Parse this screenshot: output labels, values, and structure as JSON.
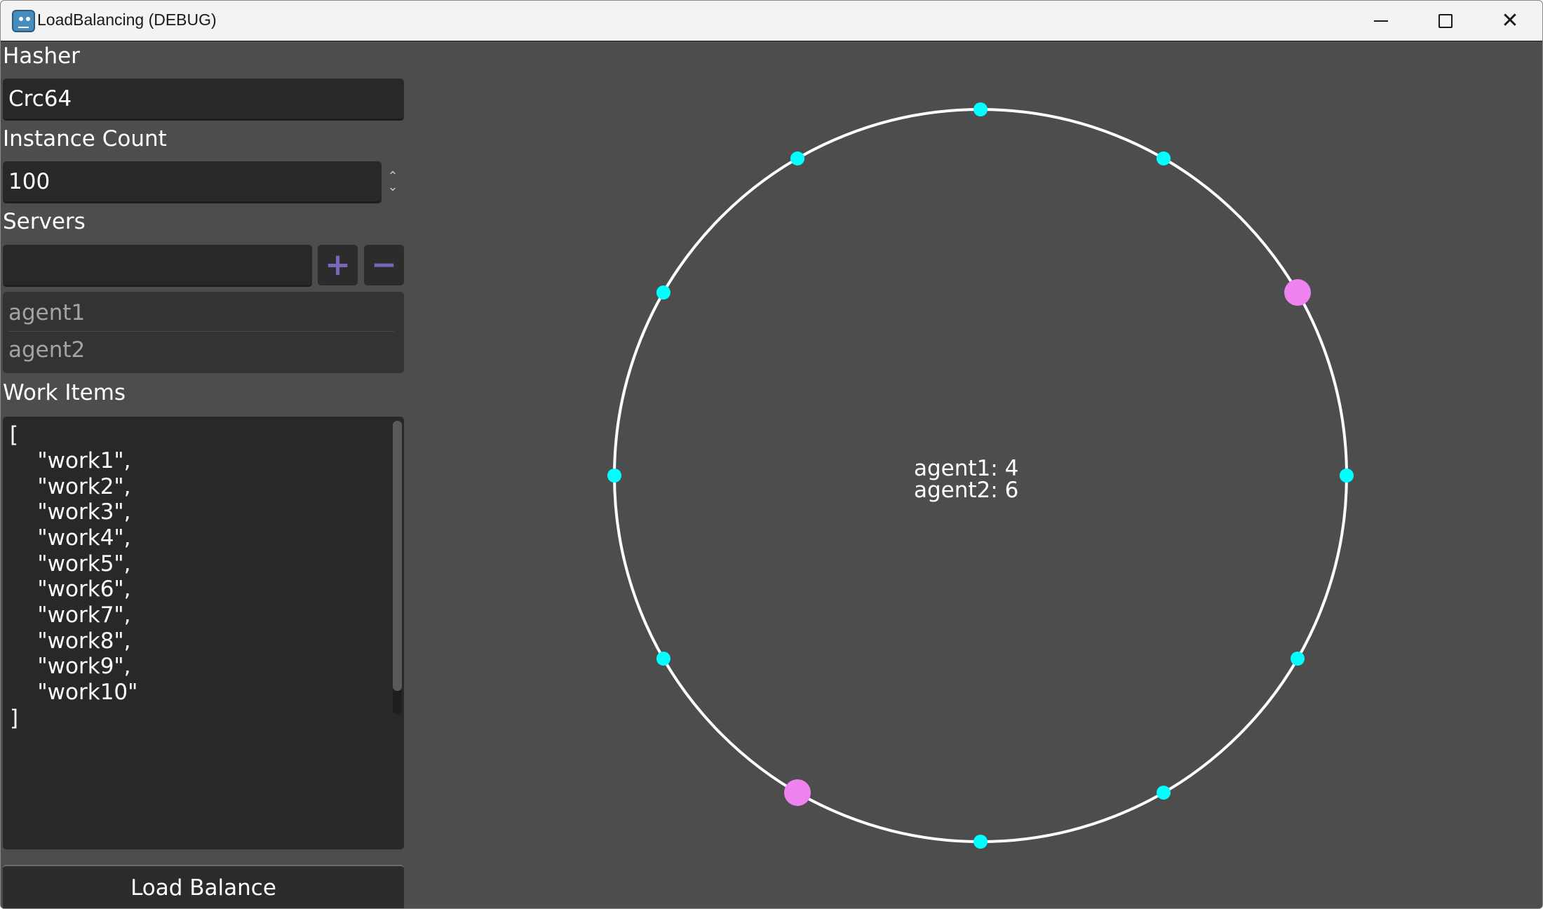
{
  "window": {
    "title": "LoadBalancing (DEBUG)",
    "minimize": "minimize",
    "maximize": "maximize",
    "close": "close"
  },
  "hasher": {
    "label": "Hasher",
    "value": "Crc64"
  },
  "instance_count": {
    "label": "Instance Count",
    "value": "100"
  },
  "servers": {
    "label": "Servers",
    "input_value": "",
    "add_label": "+",
    "remove_label": "−",
    "items": [
      "agent1",
      "agent2"
    ]
  },
  "work_items": {
    "label": "Work Items",
    "lines": [
      "[",
      "    \"work1\",",
      "    \"work2\",",
      "    \"work3\",",
      "    \"work4\",",
      "    \"work5\",",
      "    \"work6\",",
      "    \"work7\",",
      "    \"work8\",",
      "    \"work9\",",
      "    \"work10\"",
      "]"
    ]
  },
  "load_balance_button": "Load Balance",
  "ring": {
    "summary": [
      "agent1: 4",
      "agent2: 6"
    ],
    "work_node_count": 10,
    "server_node_count": 2,
    "work_node_color": "#00ffff",
    "server_node_color": "#ee82ee",
    "ring_color": "#ffffff",
    "background_color": "#4d4d4d"
  },
  "colors": {
    "titlebar_bg": "#f3f3f3",
    "panel_bg": "#4d4d4d",
    "field_bg": "#282828",
    "button_accent": "#7a66b8"
  }
}
